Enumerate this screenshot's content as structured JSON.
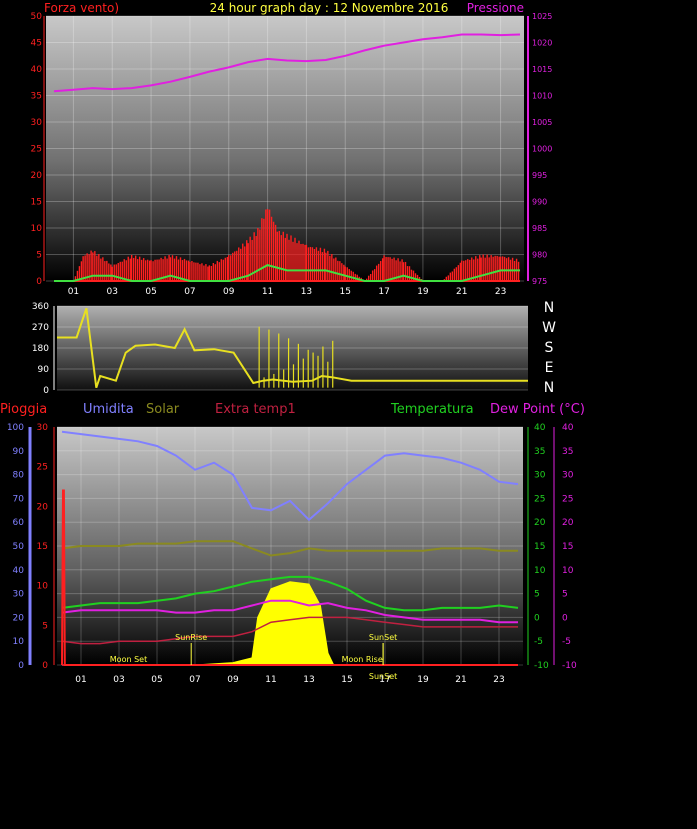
{
  "colors": {
    "wind": "#ff2020",
    "gust": "#40e040",
    "pressure": "#e020e0",
    "direction": "#e8e020",
    "humidity": "#8080ff",
    "rain": "#ff2020",
    "solar": "#8a8a20",
    "extra_temp": "#c02040",
    "temperature": "#20d020",
    "dew_point": "#e020e0",
    "solar_fill": "#ffff00",
    "pressure_axis": "#e020e0",
    "white": "#ffffff"
  },
  "header": {
    "left_label": "Forza vento)",
    "title": "24 hour graph day : 12 Novembre 2016",
    "right_label": "Pressione"
  },
  "direction_letters": [
    "N",
    "W",
    "S",
    "E",
    "N"
  ],
  "lower_labels": {
    "rain": "Pioggia",
    "humidity": "Umidita",
    "solar": "Solar",
    "extra_temp": "Extra temp1",
    "temperature": "Temperatura",
    "dew_point": "Dew Point (°C)"
  },
  "annotations": {
    "moon_set": "Moon Set",
    "sun_rise": "SunRise",
    "sun_set": "SunSet",
    "moon_rise": "Moon Rise"
  },
  "chart_data": [
    {
      "type": "line",
      "name": "wind-pressure",
      "title": "24 hour graph day : 12 Novembre 2016",
      "x_ticks": [
        "01",
        "03",
        "05",
        "07",
        "09",
        "11",
        "13",
        "15",
        "17",
        "19",
        "21",
        "23"
      ],
      "y_left": {
        "label": "Forza vento)",
        "ticks": [
          0,
          5,
          10,
          15,
          20,
          25,
          30,
          35,
          40,
          45,
          50
        ],
        "range": [
          0,
          50
        ]
      },
      "y_right": {
        "label": "Pressione",
        "ticks": [
          975,
          980,
          985,
          990,
          995,
          1000,
          1005,
          1010,
          1015,
          1020,
          1025
        ],
        "range": [
          975,
          1025
        ]
      },
      "series": [
        {
          "name": "Pressione",
          "axis": "right",
          "x": [
            0,
            1,
            2,
            3,
            4,
            5,
            6,
            7,
            8,
            9,
            10,
            11,
            12,
            13,
            14,
            15,
            16,
            17,
            18,
            19,
            20,
            21,
            22,
            23,
            24
          ],
          "values": [
            1010.8,
            1011.1,
            1011.4,
            1011.2,
            1011.4,
            1011.9,
            1012.6,
            1013.5,
            1014.5,
            1015.3,
            1016.3,
            1016.9,
            1016.6,
            1016.5,
            1016.7,
            1017.5,
            1018.5,
            1019.4,
            1020,
            1020.6,
            1021,
            1021.5,
            1021.5,
            1021.4,
            1021.5
          ]
        },
        {
          "name": "Wind",
          "axis": "left",
          "x": [
            0,
            1,
            1.5,
            2,
            3,
            4,
            5,
            6,
            7,
            8,
            9,
            10,
            10.5,
            11,
            11.5,
            12,
            13,
            14,
            15,
            16,
            17,
            18,
            19,
            20,
            21,
            22,
            23,
            24
          ],
          "values": [
            0,
            0,
            5,
            6,
            3,
            5,
            4,
            5,
            4,
            3,
            5,
            8,
            10,
            15,
            10,
            9,
            7,
            6,
            3,
            0,
            5,
            4,
            0,
            0,
            4,
            5,
            5,
            4
          ]
        },
        {
          "name": "Gust",
          "axis": "left",
          "x": [
            0,
            1,
            2,
            3,
            4,
            5,
            6,
            7,
            8,
            9,
            10,
            11,
            12,
            13,
            14,
            15,
            16,
            17,
            18,
            19,
            20,
            21,
            22,
            23,
            24
          ],
          "values": [
            0,
            0,
            1,
            1,
            0,
            0,
            1,
            0,
            0,
            0,
            1,
            3,
            2,
            2,
            2,
            1,
            0,
            0,
            1,
            0,
            0,
            0,
            1,
            2,
            2
          ]
        }
      ]
    },
    {
      "type": "line",
      "name": "wind-direction",
      "y_ticks": [
        0,
        90,
        180,
        270,
        360
      ],
      "ylim": [
        0,
        360
      ],
      "series": [
        {
          "name": "Direzione",
          "x": [
            0,
            1,
            1.5,
            2,
            2.2,
            3,
            3.5,
            4,
            5,
            6,
            6.5,
            7,
            8,
            9,
            10,
            10.5,
            11,
            12,
            13,
            13.5,
            14,
            15,
            16,
            17,
            18,
            19,
            20,
            21,
            22,
            23,
            24
          ],
          "values": [
            225,
            225,
            350,
            10,
            60,
            40,
            160,
            190,
            195,
            180,
            260,
            170,
            175,
            160,
            30,
            40,
            45,
            35,
            40,
            60,
            55,
            40,
            40,
            40,
            40,
            40,
            40,
            40,
            40,
            40,
            40
          ]
        }
      ]
    },
    {
      "type": "line",
      "name": "weather-multi",
      "x_ticks": [
        "01",
        "03",
        "05",
        "07",
        "09",
        "11",
        "13",
        "15",
        "17",
        "19",
        "21",
        "23"
      ],
      "y_axes": {
        "Pioggia": {
          "ticks": [
            0,
            10,
            20,
            30,
            40,
            50,
            60,
            70,
            80,
            90,
            100
          ],
          "range": [
            0,
            100
          ]
        },
        "Umidita": {
          "ticks": [
            0,
            5,
            10,
            15,
            20,
            25,
            30
          ],
          "range": [
            0,
            30
          ]
        },
        "Temperatura": {
          "ticks": [
            -10,
            -5,
            0,
            5,
            10,
            15,
            20,
            25,
            30,
            35,
            40
          ],
          "range": [
            -10,
            40
          ]
        },
        "Dew Point": {
          "ticks": [
            -10,
            -5,
            0,
            5,
            10,
            15,
            20,
            25,
            30,
            35,
            40
          ],
          "range": [
            -10,
            40
          ]
        }
      },
      "series": [
        {
          "name": "Umidita",
          "axis": "Pioggia",
          "x": [
            0,
            1,
            2,
            3,
            4,
            5,
            6,
            7,
            8,
            9,
            10,
            11,
            12,
            13,
            14,
            15,
            16,
            17,
            18,
            19,
            20,
            21,
            22,
            23,
            24
          ],
          "values": [
            98,
            97,
            96,
            95,
            94,
            92,
            88,
            82,
            85,
            80,
            66,
            65,
            69,
            61,
            68,
            76,
            82,
            88,
            89,
            88,
            87,
            85,
            82,
            77,
            76
          ]
        },
        {
          "name": "Solar",
          "axis": "Pioggia",
          "x": [
            0,
            1,
            2,
            3,
            4,
            5,
            6,
            7,
            8,
            9,
            10,
            11,
            12,
            13,
            14,
            15,
            16,
            17,
            18,
            19,
            20,
            21,
            22,
            23,
            24
          ],
          "values": [
            49,
            50,
            50,
            50,
            51,
            51,
            51,
            52,
            52,
            52,
            49,
            46,
            47,
            49,
            48,
            48,
            48,
            48,
            48,
            48,
            49,
            49,
            49,
            48,
            48
          ]
        },
        {
          "name": "Temperatura",
          "axis": "Temperatura",
          "x": [
            0,
            1,
            2,
            3,
            4,
            5,
            6,
            7,
            8,
            9,
            10,
            11,
            12,
            13,
            14,
            15,
            16,
            17,
            18,
            19,
            20,
            21,
            22,
            23,
            24
          ],
          "values": [
            2,
            2.5,
            3,
            3,
            3,
            3.5,
            4,
            5,
            5.5,
            6.5,
            7.5,
            8,
            8.5,
            8.5,
            7.5,
            6,
            3.5,
            2,
            1.5,
            1.5,
            2,
            2,
            2,
            2.5,
            2
          ]
        },
        {
          "name": "Dew Point",
          "axis": "Dew Point",
          "x": [
            0,
            1,
            2,
            3,
            4,
            5,
            6,
            7,
            8,
            9,
            10,
            11,
            12,
            13,
            14,
            15,
            16,
            17,
            18,
            19,
            20,
            21,
            22,
            23,
            24
          ],
          "values": [
            1,
            1.5,
            1.5,
            1.5,
            1.5,
            1.5,
            1,
            1,
            1.5,
            1.5,
            2.5,
            3.5,
            3.5,
            2.5,
            3,
            2,
            1.5,
            0.5,
            0,
            -0.5,
            -0.5,
            -0.5,
            -0.5,
            -1,
            -1
          ]
        },
        {
          "name": "Extra temp1",
          "axis": "Temperatura",
          "x": [
            0,
            1,
            2,
            3,
            4,
            5,
            6,
            7,
            8,
            9,
            10,
            11,
            12,
            13,
            14,
            15,
            16,
            17,
            18,
            19,
            20,
            21,
            22,
            23,
            24
          ],
          "values": [
            -10,
            -10,
            -10,
            -10,
            -10,
            -10,
            -10,
            -10,
            -10,
            -10,
            -10,
            -10,
            -10,
            -10,
            -10,
            -10,
            -10,
            -10,
            -10,
            -10,
            -10,
            -10,
            -10,
            -10,
            -10
          ]
        },
        {
          "name": "Extra temp1 (trend)",
          "axis": "Temperatura",
          "x": [
            0,
            1,
            2,
            3,
            4,
            5,
            6,
            7,
            8,
            9,
            10,
            11,
            12,
            13,
            14,
            15,
            16,
            17,
            18,
            19,
            20,
            21,
            22,
            23,
            24
          ],
          "values": [
            -5,
            -5.5,
            -5.5,
            -5,
            -5,
            -5,
            -4.5,
            -4,
            -4,
            -4,
            -3,
            -1,
            -0.5,
            0,
            0,
            0,
            -0.5,
            -1,
            -1.5,
            -2,
            -2,
            -2,
            -2,
            -2,
            -2
          ]
        },
        {
          "name": "Solar radiation",
          "axis": "Pioggia",
          "x": [
            0,
            7,
            9,
            10,
            10.3,
            11,
            12,
            13,
            13.6,
            14,
            14.3,
            24
          ],
          "values": [
            0,
            0,
            1,
            3,
            20,
            32,
            35,
            34,
            25,
            5,
            0,
            0
          ]
        },
        {
          "name": "Pioggia",
          "axis": "Umidita",
          "x": [
            0,
            0.05,
            0.1,
            0.15,
            24
          ],
          "values": [
            0,
            22,
            22,
            0,
            0
          ]
        }
      ],
      "events": [
        {
          "label": "Moon Set",
          "x": 3.5
        },
        {
          "label": "SunRise",
          "x": 6.8
        },
        {
          "label": "SunSet",
          "x": 16.9
        },
        {
          "label": "Moon Rise",
          "x": 15.8
        },
        {
          "label": "SunSet",
          "x": 16.9
        }
      ]
    }
  ]
}
